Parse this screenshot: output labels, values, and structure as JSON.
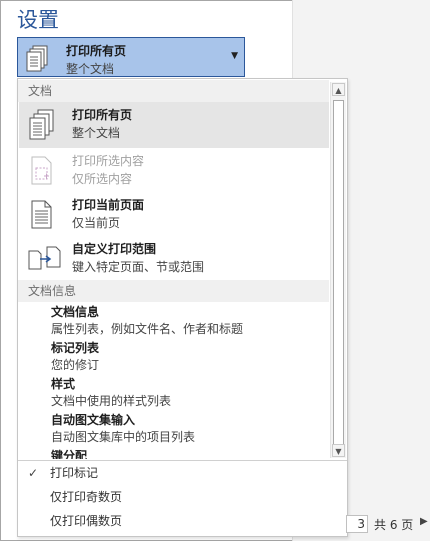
{
  "title": "设置",
  "combo": {
    "label": "打印所有页",
    "sublabel": "整个文档"
  },
  "dropdown": {
    "section_document": "文档",
    "items": [
      {
        "label": "打印所有页",
        "sublabel": "整个文档",
        "icon": "pages-icon",
        "state": "selected"
      },
      {
        "label": "打印所选内容",
        "sublabel": "仅所选内容",
        "icon": "selection-icon",
        "state": "disabled"
      },
      {
        "label": "打印当前页面",
        "sublabel": "仅当前页",
        "icon": "page-icon",
        "state": "normal"
      },
      {
        "label": "自定义打印范围",
        "sublabel": "键入特定页面、节或范围",
        "icon": "custom-range-icon",
        "state": "normal"
      }
    ],
    "section_info": "文档信息",
    "info_items": [
      {
        "label": "文档信息",
        "sublabel": "属性列表，例如文件名、作者和标题"
      },
      {
        "label": "标记列表",
        "sublabel": "您的修订"
      },
      {
        "label": "样式",
        "sublabel": "文档中使用的样式列表"
      },
      {
        "label": "自动图文集输入",
        "sublabel": "自动图文集库中的项目列表"
      },
      {
        "label": "键分配",
        "sublabel": ""
      }
    ],
    "options": [
      {
        "label": "打印标记",
        "checked": true
      },
      {
        "label": "仅打印奇数页",
        "checked": false
      },
      {
        "label": "仅打印偶数页",
        "checked": false
      }
    ],
    "check_glyph": "✓"
  },
  "pagenav": {
    "current": "3",
    "total_text": "共 6 页",
    "next_glyph": "▶"
  },
  "colors": {
    "accent": "#2b579a",
    "combo_bg": "#a8c4ea",
    "selected_bg": "#e5e5e5"
  }
}
